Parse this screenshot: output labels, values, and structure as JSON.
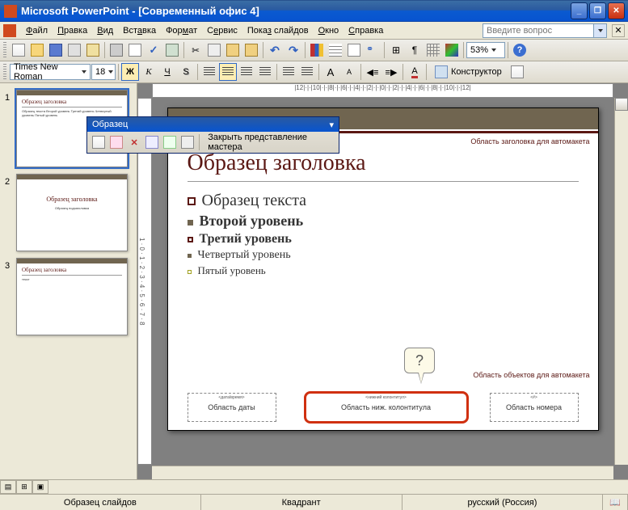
{
  "titlebar": {
    "app": "Microsoft PowerPoint",
    "doc": "[Современный офис 4]"
  },
  "menubar": {
    "items": [
      "Файл",
      "Правка",
      "Вид",
      "Вставка",
      "Формат",
      "Сервис",
      "Показ слайдов",
      "Окно",
      "Справка"
    ],
    "help_placeholder": "Введите вопрос"
  },
  "toolbar_std": {
    "zoom": "53%"
  },
  "toolbar_fmt": {
    "font_name": "Times New Roman",
    "font_size": "18",
    "designer_label": "Конструктор"
  },
  "master_toolbar": {
    "title": "Образец",
    "close_label": "Закрыть представление мастера"
  },
  "ruler_h": "|12|·|·|10|·|·|8|·|·|6|·|·|4|·|·|2|·|·|0|·|·|2|·|·|4|·|·|6|·|·|8|·|·|10|·|·|12|",
  "thumbs": [
    {
      "num": "1",
      "title": "Образец заголовка",
      "body": "Образец текста\nВторой уровень\nТретий уровень\nЧетвертый уровень\nПятый уровень",
      "selected": true
    },
    {
      "num": "2",
      "title": "Образец заголовка",
      "body": "Образец подзаголовка",
      "selected": false
    },
    {
      "num": "3",
      "title": "Образец заголовка",
      "body": "текст",
      "selected": false
    }
  ],
  "slide": {
    "autolayout_title": "Область заголовка для автомакета",
    "autolayout_body": "Область объектов для автомакета",
    "title_ph": "Образец заголовка",
    "body": {
      "l1": "Образец текста",
      "l2": "Второй уровень",
      "l3": "Третий уровень",
      "l4": "Четвертый уровень",
      "l5": "Пятый уровень"
    },
    "footer_date": {
      "tiny": "<дата/время>",
      "label": "Область даты"
    },
    "footer_center": {
      "tiny": "<нижний колонтитул>",
      "label": "Область ниж. колонтитула"
    },
    "footer_num": {
      "tiny": "<#>",
      "label": "Область номера"
    }
  },
  "callout": {
    "text": "?"
  },
  "statusbar": {
    "left": "Образец слайдов",
    "center": "Квадрант",
    "right": "русский (Россия)"
  }
}
